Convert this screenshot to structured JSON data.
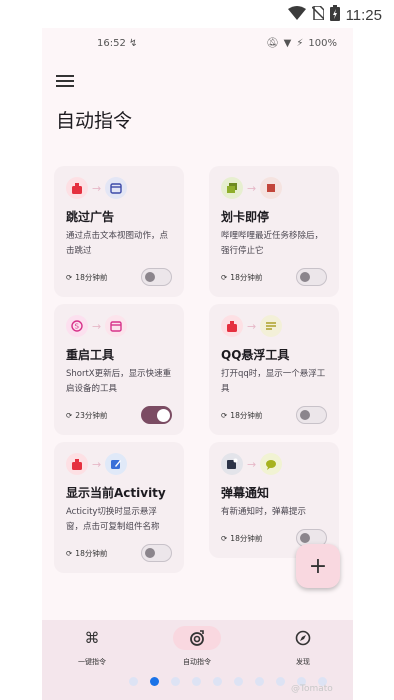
{
  "system": {
    "time": "11:25"
  },
  "phone_status": {
    "time": "16:52",
    "battery": "100%"
  },
  "page_title": "自动指令",
  "cards": [
    {
      "title": "跳过广告",
      "desc": "通过点击文本视图动作，点击跳过",
      "time": "18分钟前",
      "enabled": false
    },
    {
      "title": "划卡即停",
      "desc": "哔哩哔哩最近任务移除后，强行停止它",
      "time": "18分钟前",
      "enabled": false
    },
    {
      "title": "重启工具",
      "desc": "ShortX更新后，显示快速重启设备的工具",
      "time": "23分钟前",
      "enabled": true
    },
    {
      "title": "QQ悬浮工具",
      "desc": "打开qq时，显示一个悬浮工具",
      "time": "18分钟前",
      "enabled": false
    },
    {
      "title": "显示当前Activity",
      "desc": "Acticity切换时显示悬浮窗，点击可复制组件名称",
      "time": "18分钟前",
      "enabled": false
    },
    {
      "title": "弹幕通知",
      "desc": "有新通知时，弹幕提示",
      "time": "18分钟前",
      "enabled": false
    }
  ],
  "fab": {
    "label": "+"
  },
  "nav": [
    {
      "label": "一键指令",
      "icon": "command-icon"
    },
    {
      "label": "自动指令",
      "icon": "auto-target-icon"
    },
    {
      "label": "发现",
      "icon": "compass-icon"
    }
  ],
  "watermark": "@Tomato",
  "colors": {
    "accent": "#7b4c63",
    "fab": "#f9d8e0",
    "card": "#f6eef1",
    "page": "#fdf6f8",
    "nav": "#f4e6ec",
    "dot_active": "#1a73e8"
  }
}
